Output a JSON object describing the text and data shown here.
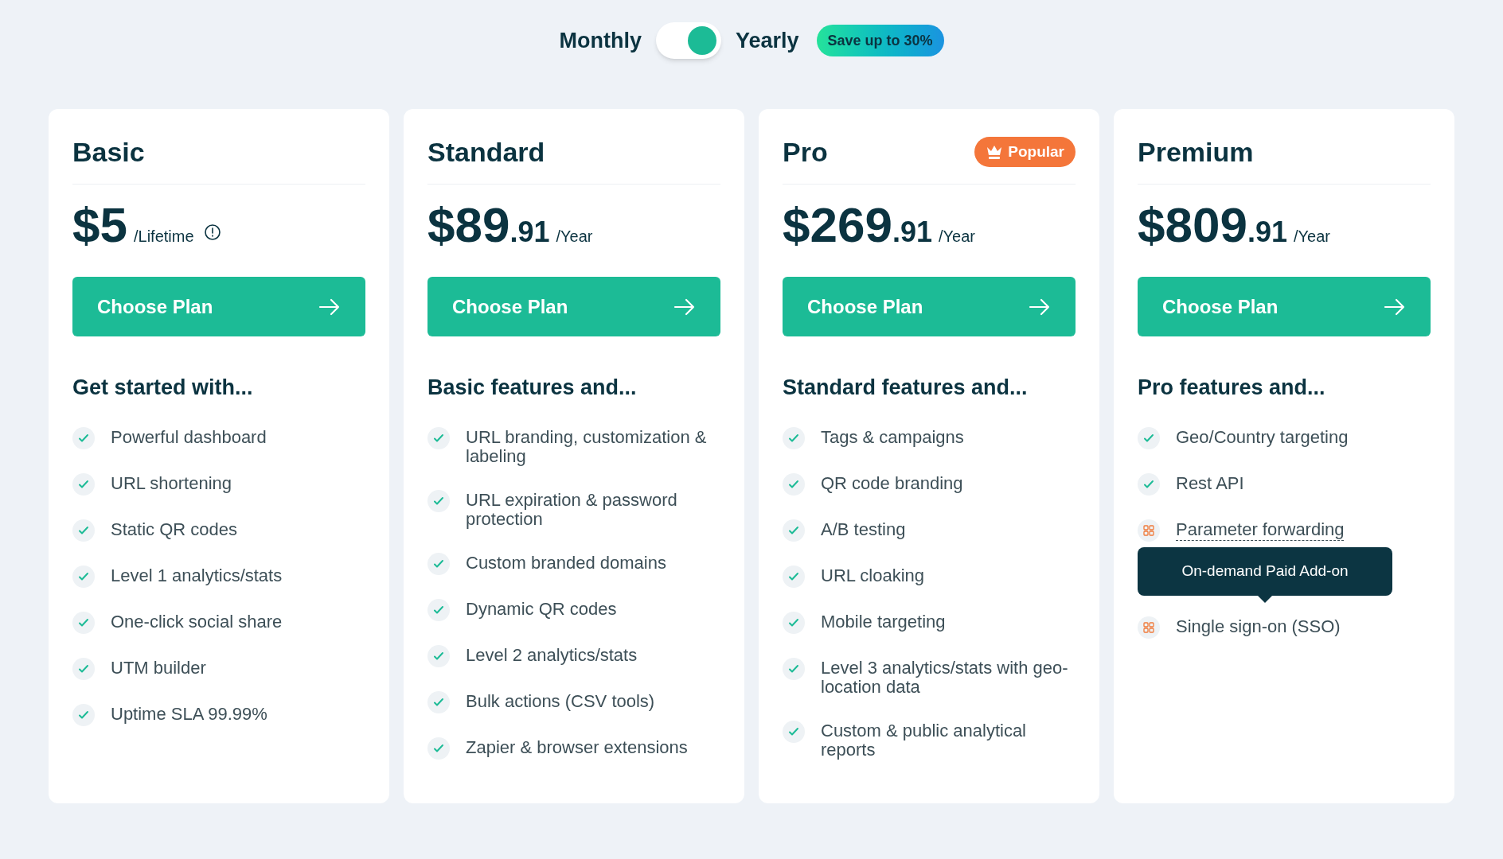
{
  "billing": {
    "monthly_label": "Monthly",
    "yearly_label": "Yearly",
    "on": true,
    "save_badge": "Save up to 30%"
  },
  "plans": [
    {
      "name": "Basic",
      "amount": "$5",
      "period": "/Lifetime",
      "info_icon": true,
      "button": "Choose Plan",
      "heading": "Get started with...",
      "features": [
        {
          "kind": "check",
          "text": "Powerful dashboard"
        },
        {
          "kind": "check",
          "text": "URL shortening"
        },
        {
          "kind": "check",
          "text": "Static QR codes"
        },
        {
          "kind": "check",
          "text": "Level 1 analytics/stats"
        },
        {
          "kind": "check",
          "text": "One-click social share"
        },
        {
          "kind": "check",
          "text": "UTM builder"
        },
        {
          "kind": "check",
          "text": "Uptime SLA 99.99%"
        }
      ]
    },
    {
      "name": "Standard",
      "amount": "$89",
      "cents": ".91",
      "period": "/Year",
      "info_icon": false,
      "button": "Choose Plan",
      "heading": "Basic features and...",
      "features": [
        {
          "kind": "check",
          "text": "URL branding, customization & labeling"
        },
        {
          "kind": "check",
          "text": "URL expiration & password protection"
        },
        {
          "kind": "check",
          "text": "Custom branded domains"
        },
        {
          "kind": "check",
          "text": "Dynamic QR codes"
        },
        {
          "kind": "check",
          "text": "Level 2 analytics/stats"
        },
        {
          "kind": "check",
          "text": "Bulk actions (CSV tools)"
        },
        {
          "kind": "check",
          "text": "Zapier & browser extensions"
        }
      ]
    },
    {
      "name": "Pro",
      "badge": "Popular",
      "amount": "$269",
      "cents": ".91",
      "period": "/Year",
      "info_icon": false,
      "button": "Choose Plan",
      "heading": "Standard features and...",
      "features": [
        {
          "kind": "check",
          "text": "Tags & campaigns"
        },
        {
          "kind": "check",
          "text": "QR code branding"
        },
        {
          "kind": "check",
          "text": "A/B testing"
        },
        {
          "kind": "check",
          "text": "URL cloaking"
        },
        {
          "kind": "check",
          "text": "Mobile targeting"
        },
        {
          "kind": "check",
          "text": "Level 3 analytics/stats with geo-location data"
        },
        {
          "kind": "check",
          "text": "Custom & public analytical reports"
        }
      ]
    },
    {
      "name": "Premium",
      "amount": "$809",
      "cents": ".91",
      "period": "/Year",
      "info_icon": false,
      "button": "Choose Plan",
      "heading": "Pro features and...",
      "features": [
        {
          "kind": "check",
          "text": "Geo/Country targeting"
        },
        {
          "kind": "check",
          "text": "Rest API"
        },
        {
          "kind": "addon",
          "text": "Parameter forwarding",
          "tooltip": "On-demand Paid Add-on"
        },
        {
          "kind": "addon",
          "text": "Single sign-on (SSO)"
        }
      ]
    }
  ]
}
